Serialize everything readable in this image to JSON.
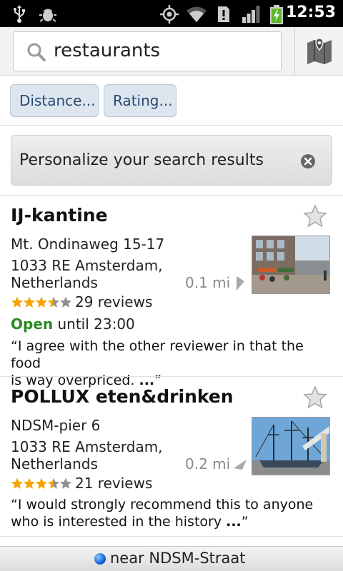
{
  "status_bar": {
    "time": "12:53",
    "icons": [
      "usb-icon",
      "debug-icon",
      "gps-icon",
      "wifi-icon",
      "alert-icon",
      "signal-icon",
      "battery-charging-icon"
    ]
  },
  "search": {
    "query": "restaurants",
    "icon": "search-icon",
    "map_button_icon": "map-icon"
  },
  "filters": {
    "distance_label": "Distance...",
    "rating_label": "Rating..."
  },
  "personalize": {
    "text": "Personalize your search results",
    "close_icon": "close-icon"
  },
  "results": [
    {
      "title": "IJ-kantine",
      "address_line1": "Mt. Ondinaweg 15-17",
      "address_line2": "1033 RE Amsterdam,",
      "address_line3": "Netherlands",
      "distance": "0.1 mi",
      "rating": 3.5,
      "reviews": "29 reviews",
      "open_label": "Open",
      "hours": " until 23:00",
      "quote_line1": "“I agree with the other reviewer in that the food",
      "quote_line2": "is way overpriced. ",
      "quote_ellipsis": "...",
      "quote_end": "”"
    },
    {
      "title": "POLLUX eten&drinken",
      "address_line1": "NDSM-pier 6",
      "address_line2": "1033 RE Amsterdam,",
      "address_line3": "Netherlands",
      "distance": "0.2 mi",
      "rating": 3.5,
      "reviews": "21 reviews",
      "quote_line1": "“I would strongly recommend this to anyone",
      "quote_line2": "who is interested in the history ",
      "quote_ellipsis": "...",
      "quote_end": "”"
    }
  ],
  "footer": {
    "location_text": "near NDSM-Straat"
  },
  "colors": {
    "open_green": "#2a8a1e",
    "chip_text": "#2a4a72",
    "star_gold": "#f5a300"
  }
}
